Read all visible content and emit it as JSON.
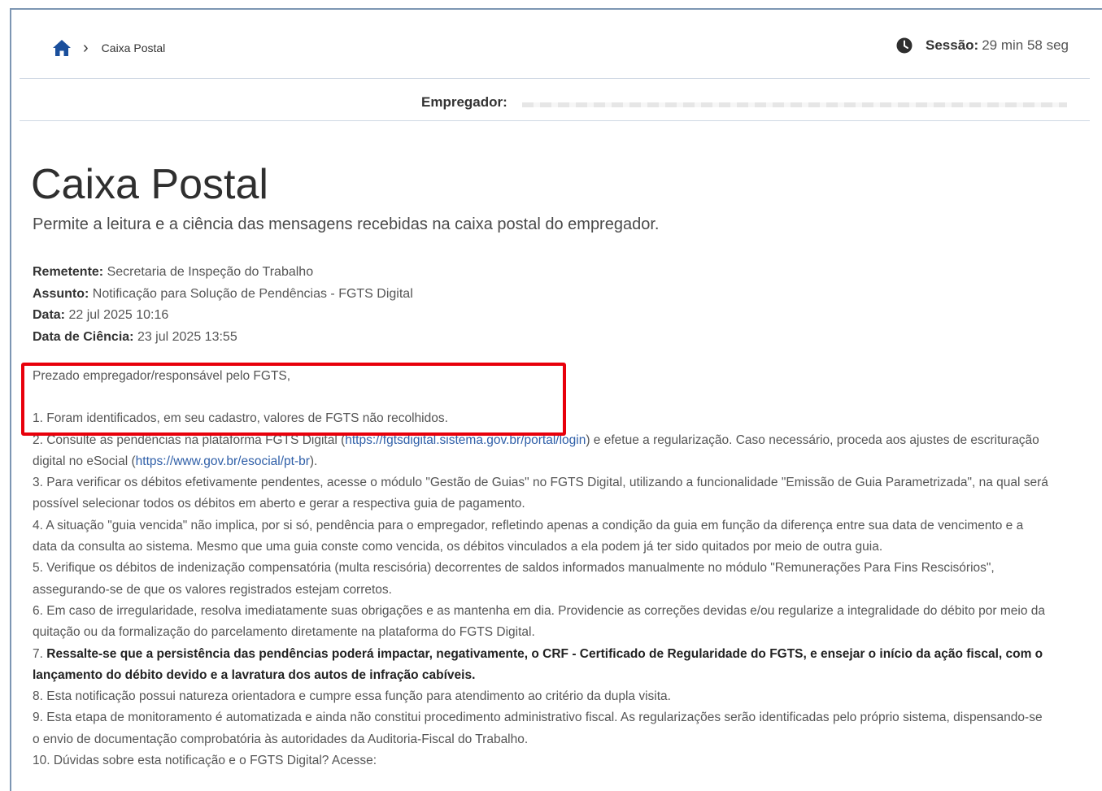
{
  "breadcrumb": {
    "current": "Caixa Postal"
  },
  "session": {
    "label": "Sessão:",
    "value": "29 min 58 seg"
  },
  "employer": {
    "label": "Empregador:"
  },
  "page": {
    "title": "Caixa Postal",
    "description": "Permite a leitura e a ciência das mensagens recebidas na caixa postal do empregador."
  },
  "meta": {
    "sender_label": "Remetente:",
    "sender": "Secretaria de Inspeção do Trabalho",
    "subject_label": "Assunto:",
    "subject": "Notificação para Solução de Pendências - FGTS Digital",
    "date_label": "Data:",
    "date": "22 jul 2025 10:16",
    "ack_label": "Data de Ciência:",
    "ack": "23 jul 2025 13:55"
  },
  "message": {
    "greeting": "Prezado empregador/responsável pelo FGTS,",
    "item1": "1. Foram identificados, em seu cadastro, valores de FGTS não recolhidos.",
    "item2_a": "2. Consulte as pendências na plataforma FGTS Digital (",
    "item2_link": "https://fgtsdigital.sistema.gov.br/portal/login",
    "item2_b": ") e efetue a regularização. Caso necessário, proceda aos ajustes de escrituração digital no eSocial (",
    "item2_link2": "https://www.gov.br/esocial/pt-br",
    "item2_c": ").",
    "item3": "3. Para verificar os débitos efetivamente pendentes, acesse o módulo \"Gestão de Guias\" no FGTS Digital, utilizando a funcionalidade \"Emissão de Guia Parametrizada\", na qual será possível selecionar todos os débitos em aberto e gerar a respectiva guia de pagamento.",
    "item4": "4. A situação \"guia vencida\" não implica, por si só, pendência para o empregador, refletindo apenas a condição da guia em função da diferença entre sua data de vencimento e a data da consulta ao sistema. Mesmo que uma guia conste como vencida, os débitos vinculados a ela podem já ter sido quitados por meio de outra guia.",
    "item5": "5. Verifique os débitos de indenização compensatória (multa rescisória) decorrentes de saldos informados manualmente no módulo \"Remunerações Para Fins Rescisórios\", assegurando-se de que os valores registrados estejam corretos.",
    "item6": "6. Em caso de irregularidade, resolva imediatamente suas obrigações e as mantenha em dia. Providencie as correções devidas e/ou regularize a integralidade do débito por meio da quitação ou da formalização do parcelamento diretamente na plataforma do FGTS Digital.",
    "item7_num": "7.",
    "item7": "Ressalte-se que a persistência das pendências poderá impactar, negativamente, o CRF - Certificado de Regularidade do FGTS, e ensejar o início da ação fiscal, com o lançamento do débito devido e a lavratura dos autos de infração cabíveis.",
    "item8": "8. Esta notificação possui natureza orientadora e cumpre essa função para atendimento ao critério da dupla visita.",
    "item9": "9. Esta etapa de monitoramento é automatizada e ainda não constitui procedimento administrativo fiscal. As regularizações serão identificadas pelo próprio sistema, dispensando-se o envio de documentação comprobatória às autoridades da Auditoria-Fiscal do Trabalho.",
    "item10": "10. Dúvidas sobre esta notificação e o FGTS Digital? Acesse:"
  },
  "colors": {
    "link": "#2f5fa8",
    "highlight": "#e8000b",
    "home_icon": "#1a4f9c"
  }
}
